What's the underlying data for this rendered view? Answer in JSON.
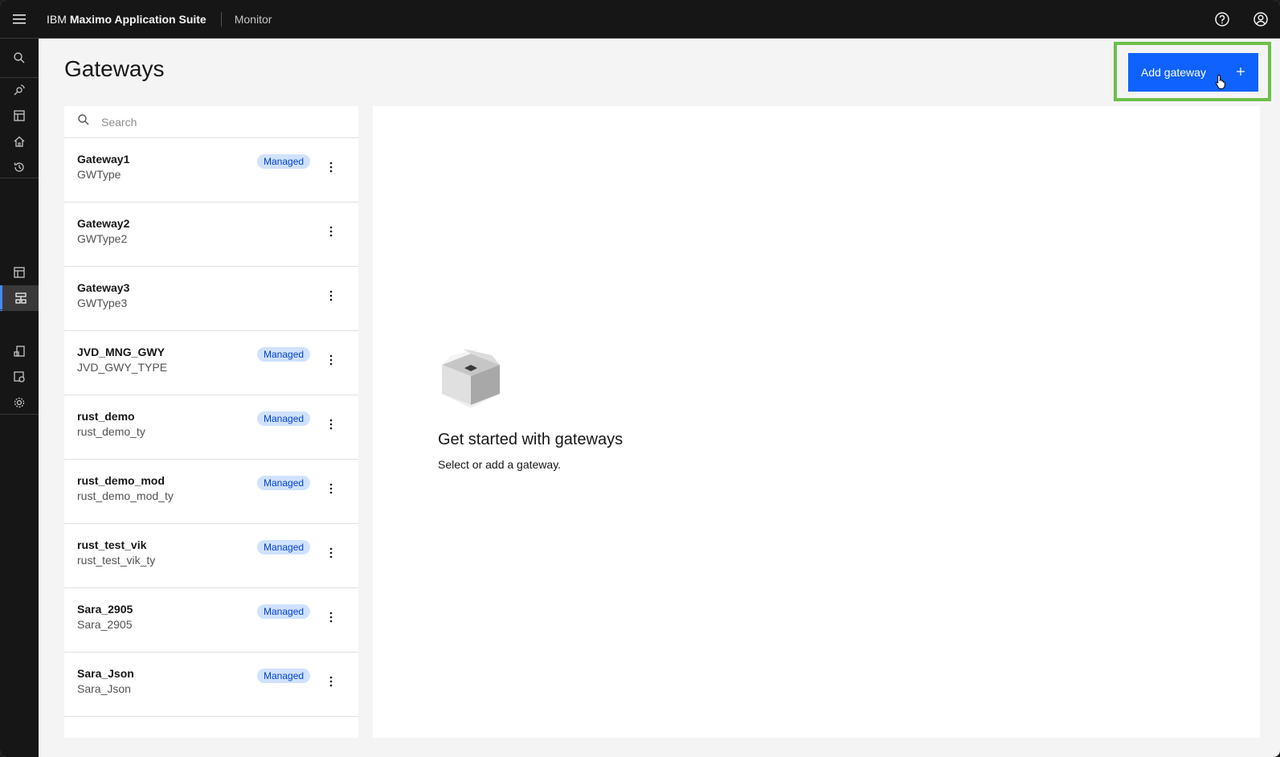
{
  "header": {
    "brand_prefix": "IBM",
    "brand_name": "Maximo Application Suite",
    "app_name": "Monitor"
  },
  "page": {
    "title": "Gateways",
    "add_button_label": "Add gateway",
    "add_button_icon": "plus-icon"
  },
  "search": {
    "placeholder": "Search"
  },
  "gateways": [
    {
      "name": "Gateway1",
      "type": "GWType",
      "tag": "Managed"
    },
    {
      "name": "Gateway2",
      "type": "GWType2",
      "tag": ""
    },
    {
      "name": "Gateway3",
      "type": "GWType3",
      "tag": ""
    },
    {
      "name": "JVD_MNG_GWY",
      "type": "JVD_GWY_TYPE",
      "tag": "Managed"
    },
    {
      "name": "rust_demo",
      "type": "rust_demo_ty",
      "tag": "Managed"
    },
    {
      "name": "rust_demo_mod",
      "type": "rust_demo_mod_ty",
      "tag": "Managed"
    },
    {
      "name": "rust_test_vik",
      "type": "rust_test_vik_ty",
      "tag": "Managed"
    },
    {
      "name": "Sara_2905",
      "type": "Sara_2905",
      "tag": "Managed"
    },
    {
      "name": "Sara_Json",
      "type": "Sara_Json",
      "tag": "Managed"
    }
  ],
  "empty_state": {
    "title": "Get started with gateways",
    "subtitle": "Select or add a gateway."
  },
  "colors": {
    "header_bg": "#161616",
    "primary": "#0f62fe",
    "tag_bg": "#d0e2ff",
    "tag_text": "#0043ce",
    "highlight": "#6cc04a"
  }
}
